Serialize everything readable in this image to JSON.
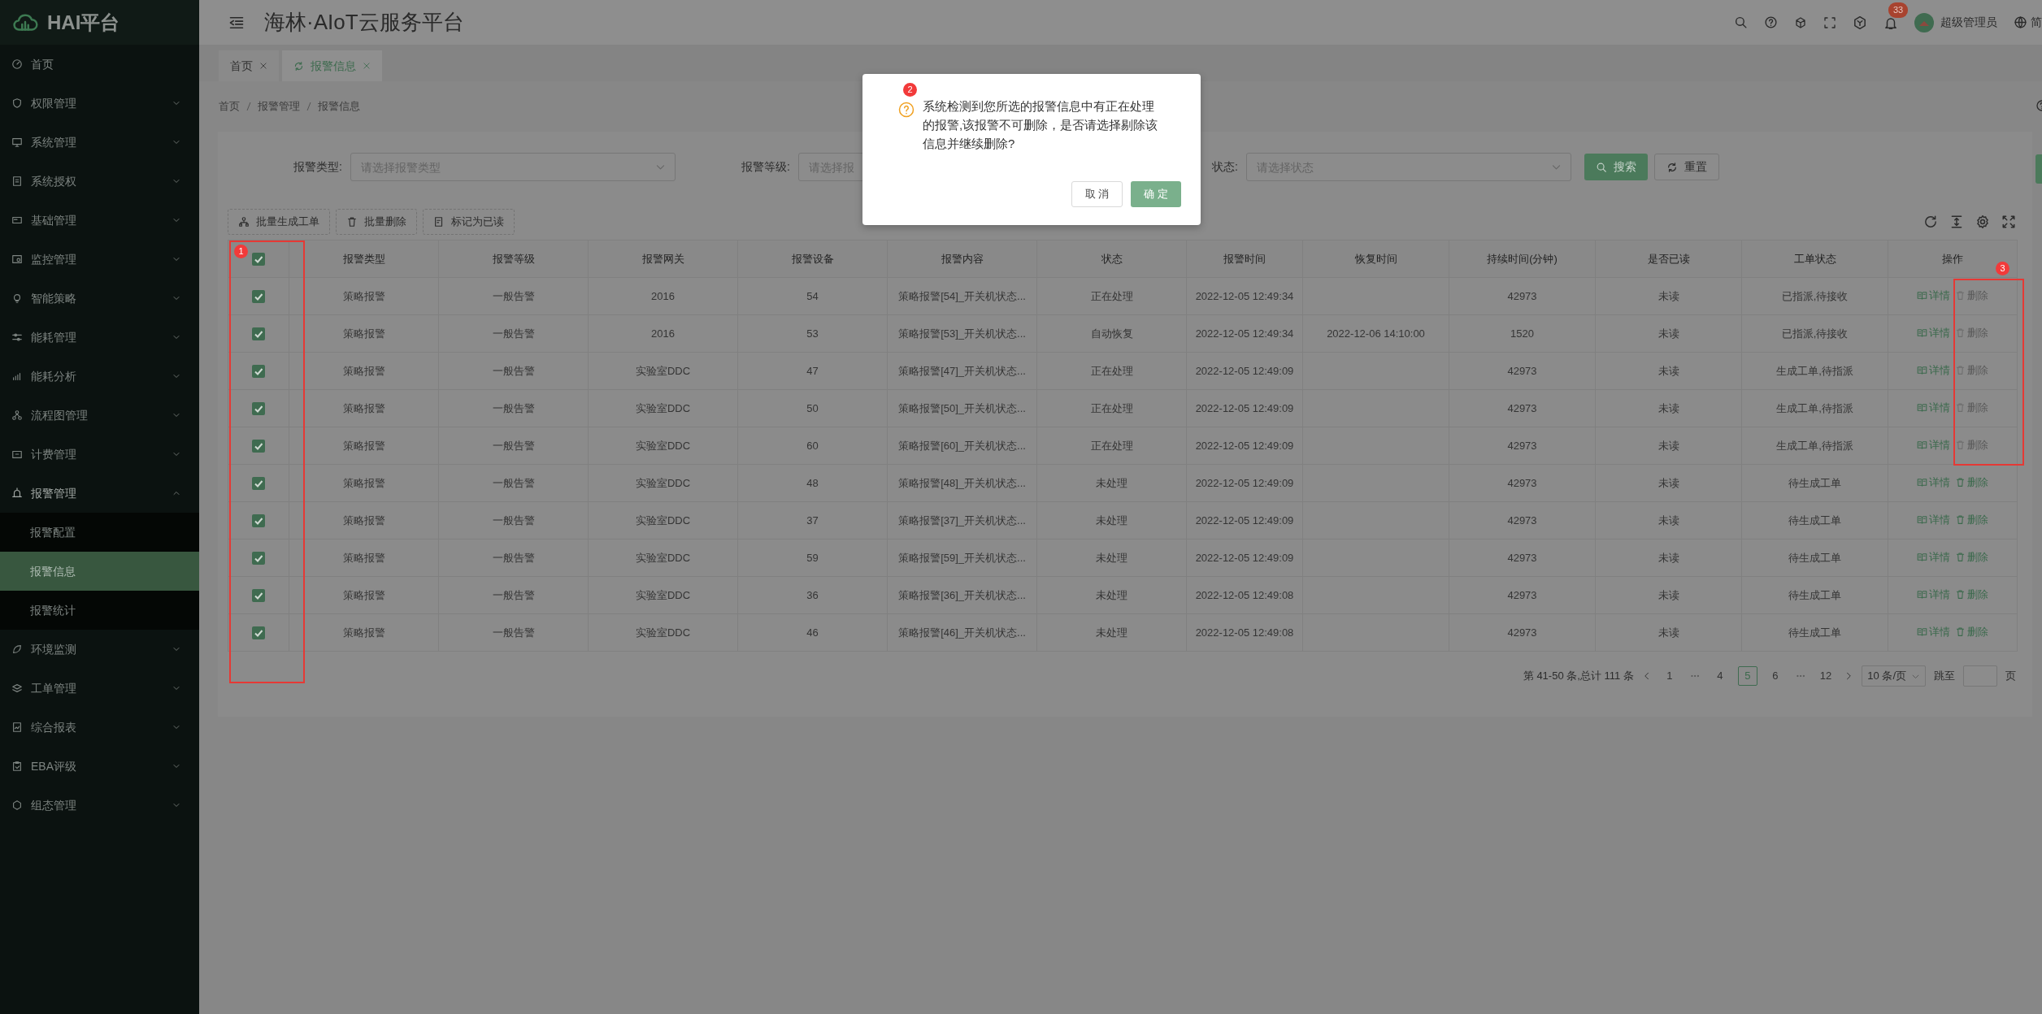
{
  "sidebar": {
    "logo": "HAI平台",
    "items": [
      {
        "kind": "link",
        "label": "首页",
        "selected": false
      },
      {
        "kind": "group",
        "label": "权限管理",
        "selected": false,
        "expanded": false
      },
      {
        "kind": "group",
        "label": "系统管理",
        "selected": false,
        "expanded": false
      },
      {
        "kind": "group",
        "label": "系统授权",
        "selected": false,
        "expanded": false
      },
      {
        "kind": "group",
        "label": "基础管理",
        "selected": false,
        "expanded": false
      },
      {
        "kind": "group",
        "label": "监控管理",
        "selected": false,
        "expanded": false
      },
      {
        "kind": "group",
        "label": "智能策略",
        "selected": false,
        "expanded": false
      },
      {
        "kind": "group",
        "label": "能耗管理",
        "selected": false,
        "expanded": false
      },
      {
        "kind": "group",
        "label": "能耗分析",
        "selected": false,
        "expanded": false
      },
      {
        "kind": "group",
        "label": "流程图管理",
        "selected": false,
        "expanded": false
      },
      {
        "kind": "group",
        "label": "计费管理",
        "selected": false,
        "expanded": false
      },
      {
        "kind": "group",
        "label": "报警管理",
        "selected": false,
        "expanded": true,
        "children": [
          {
            "label": "报警配置",
            "selected": false
          },
          {
            "label": "报警信息",
            "selected": true
          },
          {
            "label": "报警统计",
            "selected": false
          }
        ]
      },
      {
        "kind": "group",
        "label": "环境监测",
        "selected": false,
        "expanded": false
      },
      {
        "kind": "group",
        "label": "工单管理",
        "selected": false,
        "expanded": false
      },
      {
        "kind": "group",
        "label": "综合报表",
        "selected": false,
        "expanded": false
      },
      {
        "kind": "group",
        "label": "EBA评级",
        "selected": false,
        "expanded": false
      },
      {
        "kind": "group",
        "label": "组态管理",
        "selected": false,
        "expanded": false
      }
    ]
  },
  "header": {
    "title": "海林·AIoT云服务平台",
    "notifications": "33",
    "user": "超级管理员",
    "language": "简"
  },
  "tabs": [
    {
      "label": "首页",
      "selected": false
    },
    {
      "label": "报警信息",
      "selected": true
    }
  ],
  "breadcrumb": [
    "首页",
    "报警管理",
    "报警信息"
  ],
  "filters": [
    {
      "label": "报警类型:",
      "placeholder": "请选择报警类型"
    },
    {
      "label": "报警等级:",
      "placeholder": "请选择报"
    },
    {
      "label": "状态:",
      "placeholder": "请选择状态"
    }
  ],
  "search_button": "搜索",
  "reset_button": "重置",
  "toolbar": [
    "批量生成工单",
    "批量删除",
    "标记为已读"
  ],
  "table": {
    "all_checked": true,
    "columns": [
      "报警类型",
      "报警等级",
      "报警网关",
      "报警设备",
      "报警内容",
      "状态",
      "报警时间",
      "恢复时间",
      "持续时间(分钟)",
      "是否已读",
      "工单状态",
      "操作"
    ],
    "rows": [
      {
        "checked": true,
        "type": "策略报警",
        "level": "一般告警",
        "gateway": "2016",
        "device": "54",
        "content": "策略报警[54]_开关机状态...",
        "status": "正在处理",
        "time": "2022-12-05 12:49:34",
        "duration": "42973",
        "read": "未读",
        "order_status": "已指派,待接收",
        "actions": [
          {
            "label": "详情",
            "disabled": false
          },
          {
            "label": "删除",
            "disabled": true
          }
        ]
      },
      {
        "checked": true,
        "type": "策略报警",
        "level": "一般告警",
        "gateway": "2016",
        "device": "53",
        "content": "策略报警[53]_开关机状态...",
        "status": "自动恢复",
        "time": "2022-12-05 12:49:34",
        "recovered": "2022-12-06 14:10:00",
        "duration": "1520",
        "read": "未读",
        "order_status": "已指派,待接收",
        "actions": [
          {
            "label": "详情",
            "disabled": false
          },
          {
            "label": "删除",
            "disabled": true
          }
        ]
      },
      {
        "checked": true,
        "type": "策略报警",
        "level": "一般告警",
        "gateway": "实验室DDC",
        "device": "47",
        "content": "策略报警[47]_开关机状态...",
        "status": "正在处理",
        "time": "2022-12-05 12:49:09",
        "duration": "42973",
        "read": "未读",
        "order_status": "生成工单,待指派",
        "actions": [
          {
            "label": "详情",
            "disabled": false
          },
          {
            "label": "删除",
            "disabled": true
          }
        ]
      },
      {
        "checked": true,
        "type": "策略报警",
        "level": "一般告警",
        "gateway": "实验室DDC",
        "device": "50",
        "content": "策略报警[50]_开关机状态...",
        "status": "正在处理",
        "time": "2022-12-05 12:49:09",
        "duration": "42973",
        "read": "未读",
        "order_status": "生成工单,待指派",
        "actions": [
          {
            "label": "详情",
            "disabled": false
          },
          {
            "label": "删除",
            "disabled": true
          }
        ]
      },
      {
        "checked": true,
        "type": "策略报警",
        "level": "一般告警",
        "gateway": "实验室DDC",
        "device": "60",
        "content": "策略报警[60]_开关机状态...",
        "status": "正在处理",
        "time": "2022-12-05 12:49:09",
        "duration": "42973",
        "read": "未读",
        "order_status": "生成工单,待指派",
        "actions": [
          {
            "label": "详情",
            "disabled": false
          },
          {
            "label": "删除",
            "disabled": true
          }
        ]
      },
      {
        "checked": true,
        "type": "策略报警",
        "level": "一般告警",
        "gateway": "实验室DDC",
        "device": "48",
        "content": "策略报警[48]_开关机状态...",
        "status": "未处理",
        "time": "2022-12-05 12:49:09",
        "duration": "42973",
        "read": "未读",
        "order_status": "待生成工单",
        "actions": [
          {
            "label": "详情",
            "disabled": false
          },
          {
            "label": "删除",
            "disabled": false
          }
        ]
      },
      {
        "checked": true,
        "type": "策略报警",
        "level": "一般告警",
        "gateway": "实验室DDC",
        "device": "37",
        "content": "策略报警[37]_开关机状态...",
        "status": "未处理",
        "time": "2022-12-05 12:49:09",
        "duration": "42973",
        "read": "未读",
        "order_status": "待生成工单",
        "actions": [
          {
            "label": "详情",
            "disabled": false
          },
          {
            "label": "删除",
            "disabled": false
          }
        ]
      },
      {
        "checked": true,
        "type": "策略报警",
        "level": "一般告警",
        "gateway": "实验室DDC",
        "device": "59",
        "content": "策略报警[59]_开关机状态...",
        "status": "未处理",
        "time": "2022-12-05 12:49:09",
        "duration": "42973",
        "read": "未读",
        "order_status": "待生成工单",
        "actions": [
          {
            "label": "详情",
            "disabled": false
          },
          {
            "label": "删除",
            "disabled": false
          }
        ]
      },
      {
        "checked": true,
        "type": "策略报警",
        "level": "一般告警",
        "gateway": "实验室DDC",
        "device": "36",
        "content": "策略报警[36]_开关机状态...",
        "status": "未处理",
        "time": "2022-12-05 12:49:08",
        "duration": "42973",
        "read": "未读",
        "order_status": "待生成工单",
        "actions": [
          {
            "label": "详情",
            "disabled": false
          },
          {
            "label": "删除",
            "disabled": false
          }
        ]
      },
      {
        "checked": true,
        "type": "策略报警",
        "level": "一般告警",
        "gateway": "实验室DDC",
        "device": "46",
        "content": "策略报警[46]_开关机状态...",
        "status": "未处理",
        "time": "2022-12-05 12:49:08",
        "duration": "42973",
        "read": "未读",
        "order_status": "待生成工单",
        "actions": [
          {
            "label": "详情",
            "disabled": false
          },
          {
            "label": "删除",
            "disabled": false
          }
        ]
      }
    ]
  },
  "pagination": {
    "summary": "第 41-50 条,总计 111 条",
    "pages": [
      {
        "kind": "page",
        "label": "1",
        "selected": false
      },
      {
        "kind": "ellipsis"
      },
      {
        "kind": "page",
        "label": "4",
        "selected": false
      },
      {
        "kind": "page",
        "label": "5",
        "selected": true
      },
      {
        "kind": "page",
        "label": "6",
        "selected": false
      },
      {
        "kind": "ellipsis"
      },
      {
        "kind": "page",
        "label": "12",
        "selected": false
      }
    ],
    "page_size": "10 条/页",
    "jump_label": "跳至",
    "jump_unit": "页"
  },
  "dialog": {
    "message": "系统检测到您所选的报警信息中有正在处理的报警,该报警不可删除，是否请选择剔除该信息并继续删除?",
    "cancel": "取 消",
    "ok": "确 定"
  },
  "annotations": [
    {
      "kind": "checkbox-column",
      "label": "1"
    },
    {
      "kind": "dialog",
      "label": "2"
    },
    {
      "kind": "delete-actions",
      "label": "3"
    }
  ]
}
